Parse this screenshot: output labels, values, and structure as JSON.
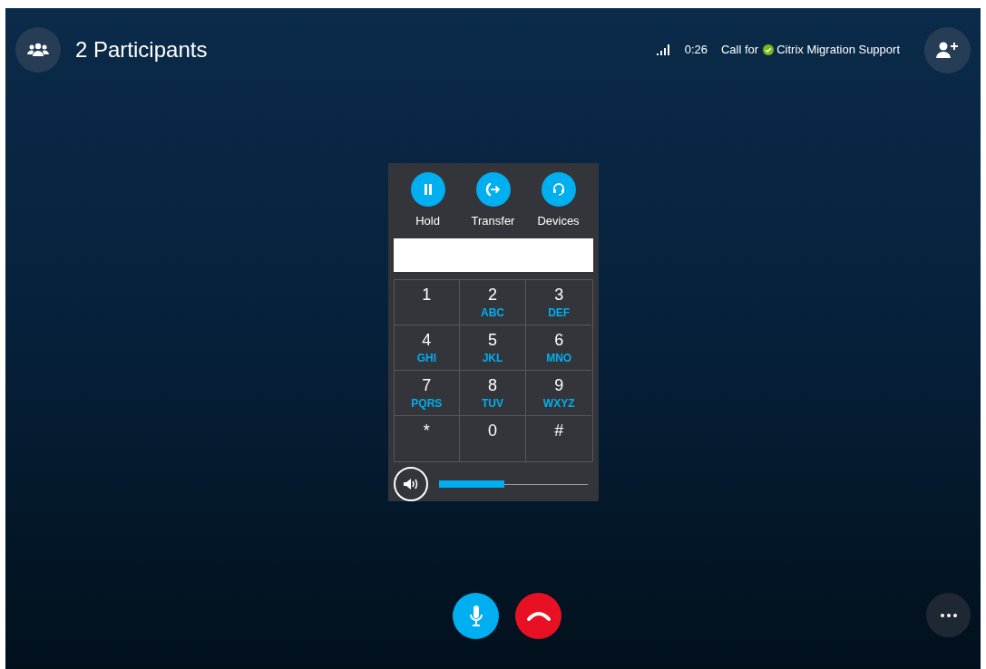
{
  "header": {
    "title": "2 Participants",
    "timer": "0:26",
    "call_for": "Call for",
    "contact": {
      "name": "Citrix Migration Support",
      "color": "#7cbb1c"
    }
  },
  "dialpad": {
    "actions": [
      {
        "kind": "hold",
        "label": "Hold"
      },
      {
        "kind": "transfer",
        "label": "Transfer"
      },
      {
        "kind": "devices",
        "label": "Devices"
      }
    ],
    "keys": [
      {
        "digit": "1"
      },
      {
        "digit": "2",
        "letters": "ABC"
      },
      {
        "digit": "3",
        "letters": "DEF"
      },
      {
        "digit": "4",
        "letters": "GHI"
      },
      {
        "digit": "5",
        "letters": "JKL"
      },
      {
        "digit": "6",
        "letters": "MNO"
      },
      {
        "digit": "7",
        "letters": "PQRS"
      },
      {
        "digit": "8",
        "letters": "TUV"
      },
      {
        "digit": "9",
        "letters": "WXYZ"
      },
      {
        "digit": "*"
      },
      {
        "digit": "0"
      },
      {
        "digit": "#"
      }
    ],
    "volume": {
      "level": 0.44
    }
  }
}
